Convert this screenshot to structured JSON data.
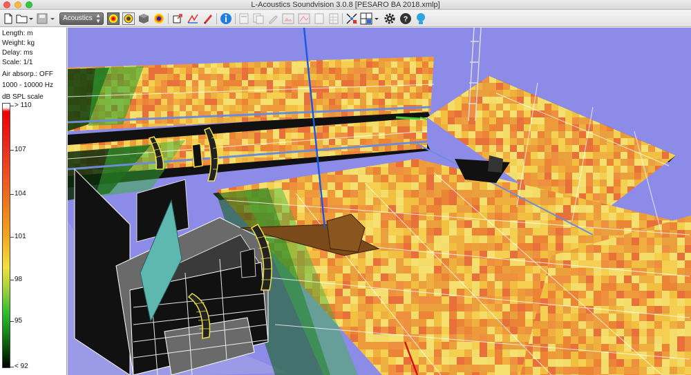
{
  "window": {
    "title": "L-Acoustics Soundvision 3.0.8 [PESARO BA 2018.xmlp]"
  },
  "toolbar": {
    "mode_select": {
      "value": "Acoustics"
    },
    "icons": [
      "new-file-icon",
      "open-file-icon",
      "save-icon",
      "mapping-3d-icon",
      "mapping-2d-icon",
      "box-object-icon",
      "coverage-icon",
      "export-icon",
      "source-autosplay-icon",
      "info-icon",
      "report-icon",
      "copy-icon",
      "edit-icon",
      "snapshot-icon",
      "map-icon",
      "page-icon",
      "zoom-fit-icon",
      "camera-view-icon",
      "settings-icon",
      "help-icon",
      "tip-icon"
    ]
  },
  "panel": {
    "length": "Length: m",
    "weight": "Weight: kg",
    "delay": "Delay: ms",
    "scale": "Scale: 1/1",
    "air": "Air absorp.: OFF",
    "freq": "1000 - 10000 Hz",
    "spl_title": "dB SPL scale",
    "spl_labels": [
      "> 110",
      "107",
      "104",
      "101",
      "98",
      "95",
      "< 92"
    ]
  },
  "colors": {
    "background": "#8c8ce8",
    "spl_high": "#e83020",
    "spl_mid": "#f2c040",
    "spl_low": "#30c030",
    "rigging_line": "#1a5adf",
    "axis_red": "#d81010"
  }
}
